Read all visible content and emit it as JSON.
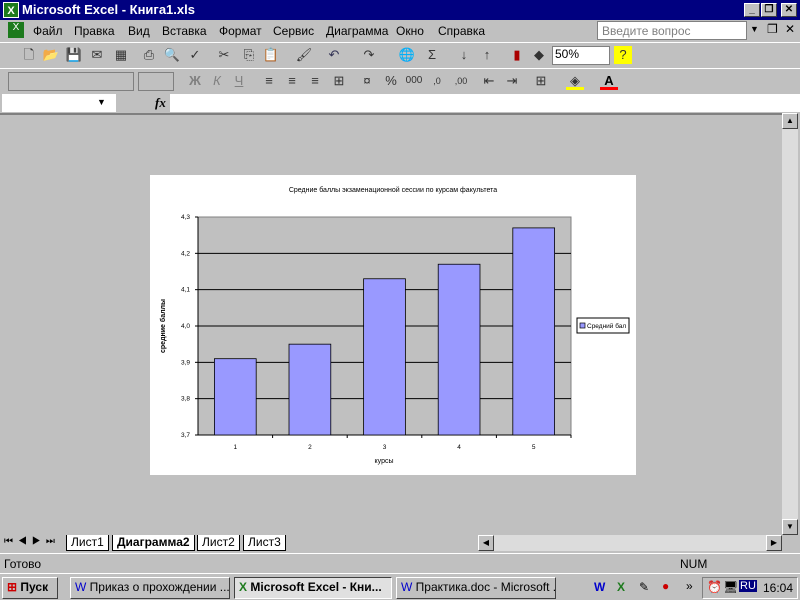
{
  "window": {
    "title": "Microsoft Excel - Книга1.xls"
  },
  "menu": [
    "Файл",
    "Правка",
    "Вид",
    "Вставка",
    "Формат",
    "Сервис",
    "Диаграмма",
    "Окно",
    "Справка"
  ],
  "help_placeholder": "Введите вопрос",
  "zoom": "50%",
  "toolbar2": {
    "bold": "Ж",
    "italic": "К",
    "underline": "Ч"
  },
  "fx": "fx",
  "chart_data": {
    "type": "bar",
    "title": "Средние баллы экзаменационной сессии по курсам факультета",
    "xlabel": "курсы",
    "ylabel": "средние баллы",
    "categories": [
      "1",
      "2",
      "3",
      "4",
      "5"
    ],
    "series": [
      {
        "name": "Средний бал",
        "values": [
          3.91,
          3.95,
          4.13,
          4.17,
          4.27
        ]
      }
    ],
    "ylim": [
      3.7,
      4.3
    ],
    "yticks": [
      "3,7",
      "3,8",
      "3,9",
      "4,0",
      "4,1",
      "4,2",
      "4,3"
    ],
    "grid": true,
    "legend": "right",
    "colors": {
      "bar": "#9999ff",
      "plot": "#c0c0c0"
    }
  },
  "tabs": [
    "Лист1",
    "Диаграмма2",
    "Лист2",
    "Лист3"
  ],
  "status": {
    "text": "Готово",
    "num": "NUM"
  },
  "taskbar": {
    "start": "Пуск",
    "tasks": [
      "Приказ о прохождении ...",
      "Microsoft Excel - Кни...",
      "Практика.doc - Microsoft ..."
    ],
    "lang": "RU",
    "clock": "16:04"
  }
}
